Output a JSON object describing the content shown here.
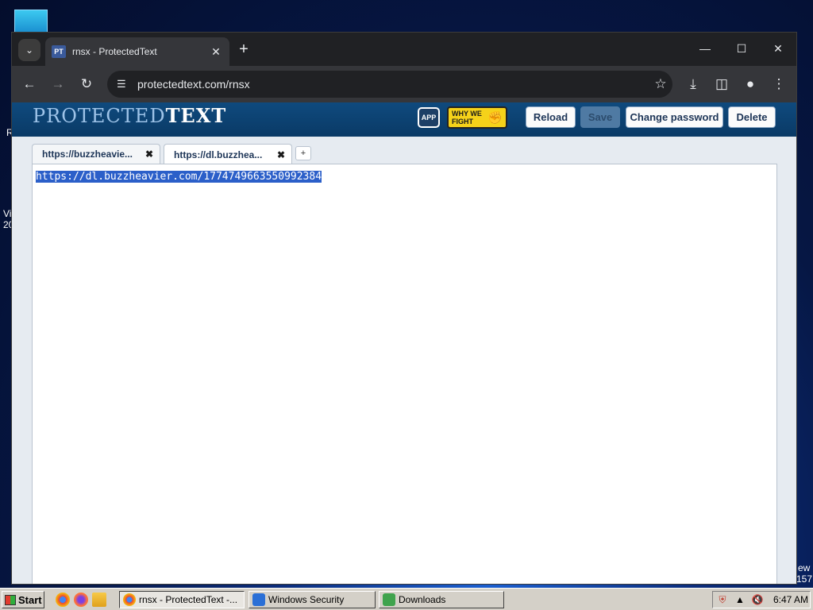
{
  "desktop": {
    "fragments": [
      "R",
      "Vi",
      "20",
      "ew",
      "157"
    ]
  },
  "browser": {
    "tab_title": "rnsx - ProtectedText",
    "favicon_text": "PT",
    "url": "protectedtext.com/rnsx"
  },
  "site": {
    "logo_light": "PROTECTED",
    "logo_bold": "TEXT",
    "app_icon_text": "APP",
    "fight_badge": "WHY WE FIGHT",
    "buttons": {
      "reload": "Reload",
      "save": "Save",
      "change_password": "Change password",
      "delete": "Delete"
    },
    "doc_tabs": [
      {
        "label": "https://buzzheavie...",
        "active": false
      },
      {
        "label": "https://dl.buzzhea...",
        "active": true
      }
    ],
    "add_tab": "+",
    "editor_content": "https://dl.buzzheavier.com/1774749663550992384"
  },
  "taskbar": {
    "start": "Start",
    "items": [
      {
        "label": "rnsx - ProtectedText -...",
        "active": true
      },
      {
        "label": "Windows Security",
        "active": false
      },
      {
        "label": "Downloads",
        "active": false
      }
    ],
    "clock": "6:47 AM"
  },
  "colors": {
    "header_blue": "#0f4a7e",
    "selection_blue": "#2b5fc9",
    "fight_yellow": "#f5d21a"
  }
}
